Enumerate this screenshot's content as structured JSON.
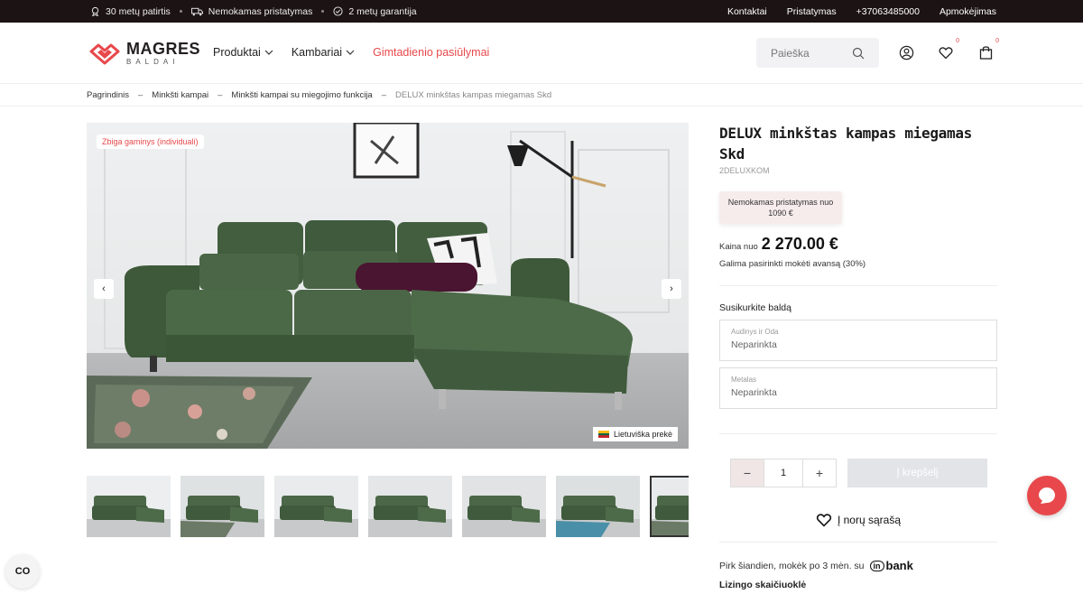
{
  "topbar": {
    "items": [
      "30 metų patirtis",
      "Nemokamas pristatymas",
      "2 metų garantija"
    ],
    "links": [
      "Kontaktai",
      "Pristatymas",
      "+37063485000",
      "Apmokėjimas"
    ]
  },
  "header": {
    "logo_main": "MAGRES",
    "logo_sub": "BALDAI",
    "nav": [
      "Produktai",
      "Kambariai",
      "Gimtadienio pasiūlymai"
    ],
    "search_placeholder": "Paieška",
    "wishlist_count": "0",
    "cart_count": "0"
  },
  "breadcrumb": {
    "items": [
      "Pagrindinis",
      "Minkšti kampai",
      "Minkšti kampai su miegojimo funkcija",
      "DELUX minkštas kampas miegamas Skd"
    ],
    "separator": "–"
  },
  "gallery": {
    "tag": "Zbiga gaminys (individuali)",
    "origin_badge": "Lietuviška prekė",
    "prev_arrow": "‹",
    "next_arrow": "›",
    "thumb_count": 7,
    "active_thumb": 7
  },
  "product": {
    "title": "DELUX minkštas kampas miegamas Skd",
    "sku": "2DELUXKOM",
    "free_shipping": "Nemokamas pristatymas nuo 1090 €",
    "price_label": "Kaina nuo",
    "price": "2 270.00 €",
    "advance_note": "Galima pasirinkti mokėti avansą (30%)",
    "build_label": "Susikurkite baldą",
    "options": [
      {
        "label": "Audinys ir Oda",
        "value": "Neparinkta"
      },
      {
        "label": "Metalas",
        "value": "Neparinkta"
      }
    ],
    "qty": "1",
    "minus": "−",
    "plus": "+",
    "add_to_cart": "Į krepšelį",
    "wishlist": "Į norų sąrašą",
    "inbank_text": "Pirk šiandien, mokėk po 3 mėn. su",
    "inbank_in": "in",
    "inbank_brand": "bank",
    "leasing": "Lizingo skaičiuoklė"
  },
  "cookie_label": "CO",
  "colors": {
    "topbar_bg": "#1c1315",
    "accent": "#e8484b",
    "sofa": "#3f5a3c"
  }
}
